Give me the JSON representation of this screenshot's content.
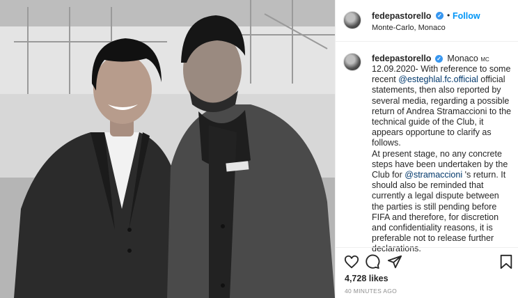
{
  "header": {
    "username": "fedepastorello",
    "follow_label": "Follow",
    "separator": "•",
    "location": "Monte-Carlo, Monaco"
  },
  "caption": {
    "username": "fedepastorello",
    "location_tag": "Monaco",
    "location_suffix": "MC",
    "line1_text": "12.09.2020- With reference to some recent ",
    "mention1": "@esteghlal.fc.official",
    "line1_rest": " official statements, then also reported by several media, regarding a possible return of Andrea Stramaccioni to the technical guide of the Club, it appears opportune to clarify as follows.",
    "para2_start": "At present stage, no any concrete steps have been undertaken by the Club for ",
    "mention2": "@stramaccioni",
    "para2_rest": " 's return. It should also be reminded that currently a legal dispute between the parties is still pending before FIFA and therefore, for discretion and confidentiality reasons, it is preferable not to release further declarations."
  },
  "footer": {
    "icons": [
      "heart-icon",
      "comment-icon",
      "share-icon",
      "bookmark-icon"
    ],
    "likes": "4,728 likes",
    "timestamp": "40 MINUTES AGO"
  },
  "colors": {
    "follow": "#0095f6",
    "verified": "#3897f0",
    "mention": "#00376b",
    "muted": "#8e8e8e"
  }
}
